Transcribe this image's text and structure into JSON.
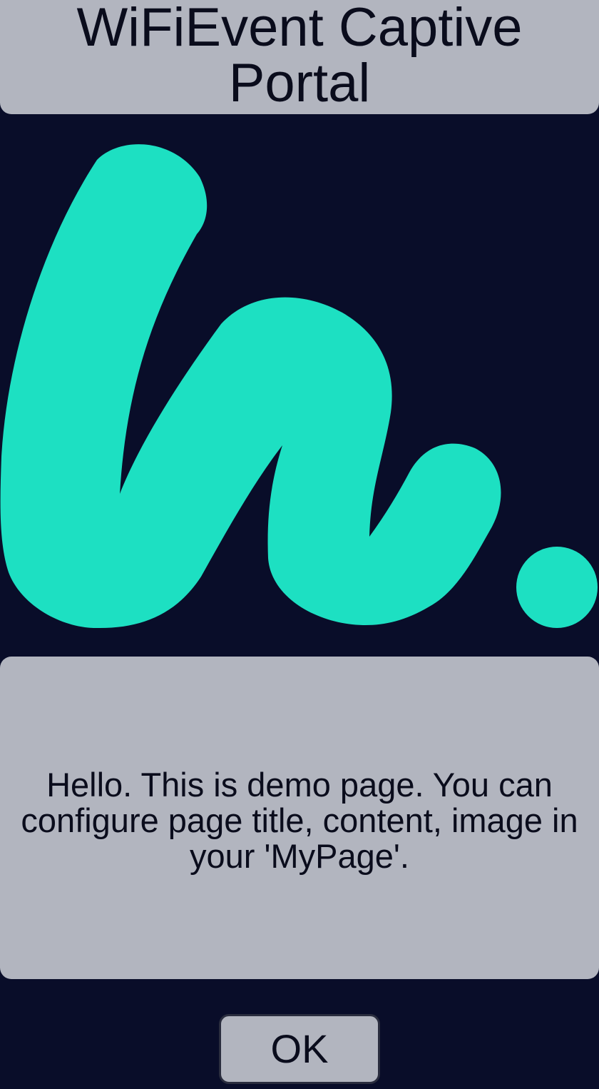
{
  "header": {
    "title": "WiFiEvent Captive Portal"
  },
  "logo": {
    "icon": "brand-logo-icon",
    "color": "#1de0c2"
  },
  "content": {
    "message": "Hello. This is demo page. You can configure page title, content, image in your 'MyPage'."
  },
  "actions": {
    "ok_label": "OK"
  },
  "colors": {
    "background": "#090d29",
    "card": "#b2b5bf",
    "text": "#0a0c1c",
    "accent": "#1de0c2"
  }
}
